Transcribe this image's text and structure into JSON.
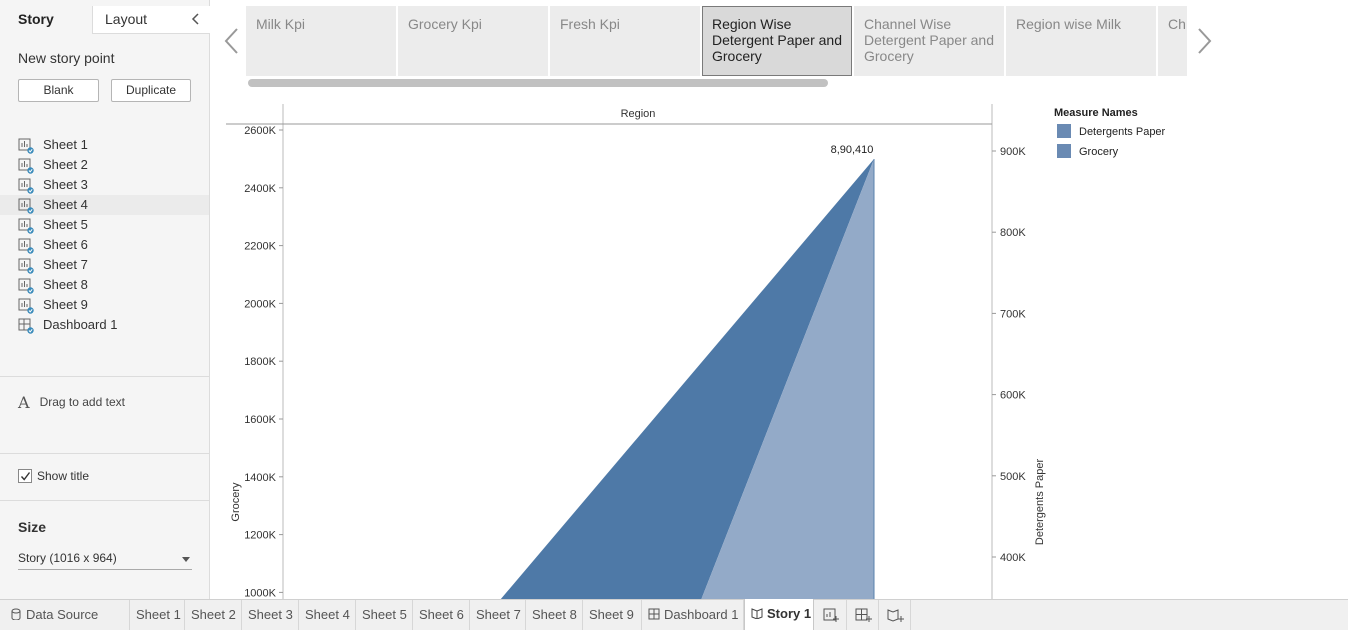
{
  "left_panel": {
    "tab_story": "Story",
    "tab_layout": "Layout",
    "new_story_point": "New story point",
    "blank_button": "Blank",
    "duplicate_button": "Duplicate",
    "sheets": [
      "Sheet 1",
      "Sheet 2",
      "Sheet 3",
      "Sheet 4",
      "Sheet 5",
      "Sheet 6",
      "Sheet 7",
      "Sheet 8",
      "Sheet 9",
      "Dashboard 1"
    ],
    "drag_text": "Drag to add text",
    "show_title": "Show title",
    "show_title_checked": true,
    "size_label": "Size",
    "size_value": "Story (1016 x 964)"
  },
  "story_points": [
    {
      "label": "Milk Kpi",
      "active": false
    },
    {
      "label": "Grocery Kpi",
      "active": false
    },
    {
      "label": "Fresh Kpi",
      "active": false
    },
    {
      "label": "Region Wise Detergent Paper and Grocery",
      "active": true
    },
    {
      "label": "Channel Wise Detergent Paper and Grocery",
      "active": false
    },
    {
      "label": "Region wise Milk",
      "active": false
    },
    {
      "label": "Ch De Fro",
      "active": false
    }
  ],
  "chart_data": {
    "type": "area",
    "title": "",
    "column_header": "Region",
    "left_axis_label": "Grocery",
    "right_axis_label": "Detergents Paper",
    "left_ticks": [
      "2600K",
      "2400K",
      "2200K",
      "2000K",
      "1800K",
      "1600K",
      "1400K",
      "1200K",
      "1000K"
    ],
    "right_ticks": [
      "900K",
      "800K",
      "700K",
      "600K",
      "500K",
      "400K"
    ],
    "left_range_visible": [
      1000000,
      2600000
    ],
    "right_range_visible": [
      400000,
      900000
    ],
    "peak_label": "8,90,410",
    "series": [
      {
        "name": "Detergents Paper",
        "color": "#4e79a7",
        "peak_value": 890410
      },
      {
        "name": "Grocery",
        "color": "#8fa9c6"
      }
    ],
    "legend_title": "Measure Names",
    "legend_placement": "right"
  },
  "bottom_tabs": [
    {
      "label": "Data Source",
      "icon": "database-icon"
    },
    {
      "label": "Sheet 1"
    },
    {
      "label": "Sheet 2"
    },
    {
      "label": "Sheet 3"
    },
    {
      "label": "Sheet 4"
    },
    {
      "label": "Sheet 5"
    },
    {
      "label": "Sheet 6"
    },
    {
      "label": "Sheet 7"
    },
    {
      "label": "Sheet 8"
    },
    {
      "label": "Sheet 9"
    },
    {
      "label": "Dashboard 1",
      "icon": "dashboard-icon"
    },
    {
      "label": "Story 1",
      "icon": "story-icon",
      "active": true
    }
  ]
}
